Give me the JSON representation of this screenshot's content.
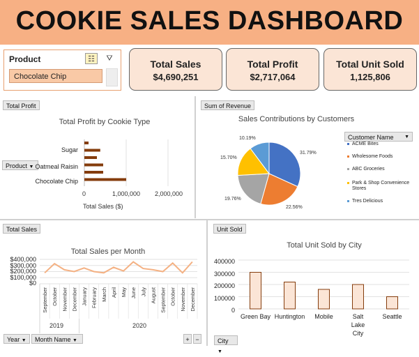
{
  "header": {
    "title": "COOKIE SALES DASHBOARD"
  },
  "slicer": {
    "title": "Product",
    "selected": "Chocolate Chip",
    "multi_select_icon": "multi-select-icon",
    "clear_filter_icon": "clear-filter-icon"
  },
  "kpis": [
    {
      "label": "Total Sales",
      "value": "$4,690,251"
    },
    {
      "label": "Total Profit",
      "value": "$2,717,064"
    },
    {
      "label": "Total Unit Sold",
      "value": "1,125,806"
    }
  ],
  "profit_panel": {
    "field_button": "Total Profit",
    "row_button": "Product",
    "chart_data": {
      "type": "bar",
      "title": "Total Profit by Cookie Type",
      "xlabel": "Total Sales ($)",
      "categories": [
        "Chocolate Chip",
        "Oatmeal Raisin",
        "Sugar"
      ],
      "values": [
        1000000,
        450000,
        380000
      ],
      "extra_bars": [
        300000,
        450000,
        100000
      ],
      "xlim": [
        0,
        2000000
      ],
      "tick_labels": [
        "0",
        "1,000,000",
        "2,000,000"
      ],
      "bar_color": "#843c0c"
    }
  },
  "pie_panel": {
    "field_button": "Sum of Revenue",
    "legend_button": "Customer Name",
    "chart_data": {
      "type": "pie",
      "title": "Sales Contributions by Customers",
      "labels": [
        "ACME Bites",
        "Wholesome Foods",
        "ABC Groceries",
        "Park & Shop Convenience Stores",
        "Tres Delicious"
      ],
      "values": [
        31.79,
        22.56,
        19.76,
        15.7,
        10.19
      ],
      "value_labels": [
        "31.79%",
        "22.56%",
        "19.76%",
        "15.70%",
        "10.19%"
      ],
      "colors": [
        "#4472c4",
        "#ed7d31",
        "#a5a5a5",
        "#ffc000",
        "#5b9bd5"
      ]
    }
  },
  "month_panel": {
    "field_button": "Total Sales",
    "axis_buttons": [
      "Year",
      "Month Name"
    ],
    "chart_data": {
      "type": "line",
      "title": "Total Sales per Month",
      "y_tick_labels": [
        "$400,000",
        "$300,000",
        "$200,000",
        "$100,000",
        "$0"
      ],
      "ylim": [
        0,
        400000
      ],
      "x": [
        "September",
        "October",
        "November",
        "December",
        "January",
        "February",
        "March",
        "April",
        "May",
        "June",
        "July",
        "August",
        "September",
        "October",
        "November",
        "December"
      ],
      "years": [
        {
          "label": "2019"
        },
        {
          "label": "2020"
        }
      ],
      "values": [
        180000,
        330000,
        230000,
        200000,
        260000,
        200000,
        180000,
        270000,
        210000,
        360000,
        250000,
        230000,
        200000,
        340000,
        180000,
        360000
      ],
      "line_color": "#f4b183"
    }
  },
  "city_panel": {
    "field_button": "Unit Sold",
    "axis_button": "City",
    "chart_data": {
      "type": "bar",
      "title": "Total Unit Sold by City",
      "categories": [
        "Green Bay",
        "Huntington",
        "Mobile",
        "Salt Lake City",
        "Seattle"
      ],
      "values": [
        300000,
        220000,
        160000,
        200000,
        100000
      ],
      "ylim": [
        0,
        400000
      ],
      "y_tick_labels": [
        "400000",
        "300000",
        "200000",
        "100000",
        "0"
      ],
      "bar_fill": "#fbe5d6",
      "bar_stroke": "#843c0c"
    }
  },
  "expand_controls": {
    "plus": "+",
    "minus": "−"
  }
}
